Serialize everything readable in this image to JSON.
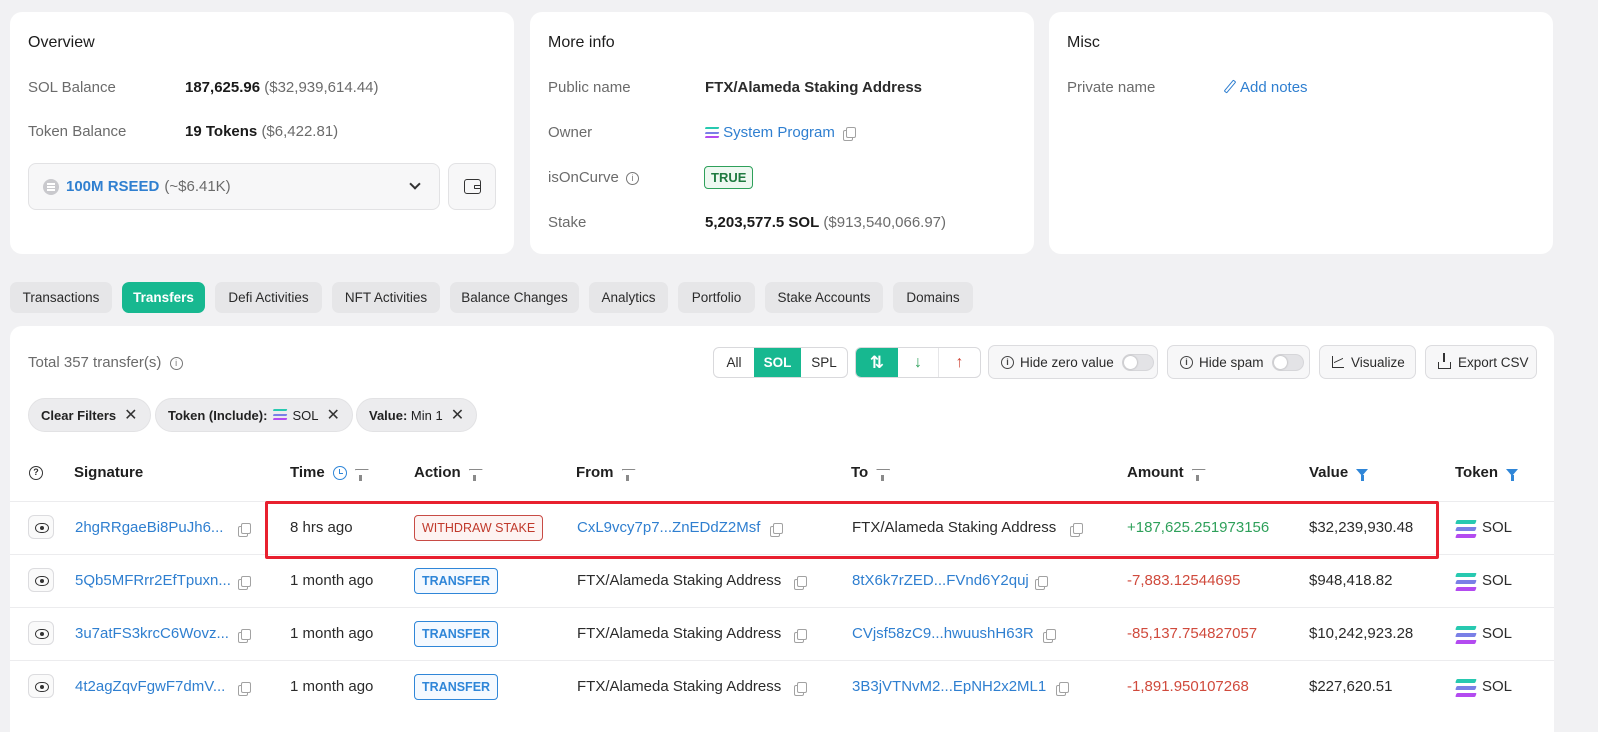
{
  "overview": {
    "title": "Overview",
    "sol_balance_label": "SOL Balance",
    "sol_balance_value": "187,625.96",
    "sol_balance_usd": "($32,939,614.44)",
    "token_balance_label": "Token Balance",
    "token_balance_value": "19 Tokens",
    "token_balance_usd": "($6,422.81)",
    "token_select_value": "100M RSEED",
    "token_select_usd": "(~$6.41K)"
  },
  "more_info": {
    "title": "More info",
    "public_name_label": "Public name",
    "public_name_value": "FTX/Alameda Staking Address",
    "owner_label": "Owner",
    "owner_value": "System Program",
    "is_on_curve_label": "isOnCurve",
    "is_on_curve_value": "TRUE",
    "stake_label": "Stake",
    "stake_value": "5,203,577.5 SOL",
    "stake_usd": "($913,540,066.97)"
  },
  "misc": {
    "title": "Misc",
    "private_name_label": "Private name",
    "add_notes": "Add notes"
  },
  "tabs": [
    "Transactions",
    "Transfers",
    "Defi Activities",
    "NFT Activities",
    "Balance Changes",
    "Analytics",
    "Portfolio",
    "Stake Accounts",
    "Domains"
  ],
  "active_tab": "Transfers",
  "toolbar": {
    "total": "Total 357 transfer(s)",
    "filter_all": "All",
    "filter_sol": "SOL",
    "filter_spl": "SPL",
    "hide_zero": "Hide zero value",
    "hide_spam": "Hide spam",
    "visualize": "Visualize",
    "export_csv": "Export CSV"
  },
  "chips": {
    "clear": "Clear Filters",
    "token_label": "Token (Include):",
    "token_value": "SOL",
    "value_label": "Value:",
    "value_value": "Min 1"
  },
  "table": {
    "headers": {
      "signature": "Signature",
      "time": "Time",
      "action": "Action",
      "from": "From",
      "to": "To",
      "amount": "Amount",
      "value": "Value",
      "token": "Token"
    },
    "rows": [
      {
        "signature": "2hgRRgaeBi8PuJh6...",
        "time": "8 hrs ago",
        "action": "WITHDRAW STAKE",
        "from": "CxL9vcy7p7...ZnEDdZ2Msf",
        "to": "FTX/Alameda Staking Address",
        "amount": "+187,625.251973156",
        "value": "$32,239,930.48",
        "token": "SOL"
      },
      {
        "signature": "5Qb5MFRrr2EfTpuxn...",
        "time": "1 month ago",
        "action": "TRANSFER",
        "from": "FTX/Alameda Staking Address",
        "to": "8tX6k7rZED...FVnd6Y2quj",
        "amount": "-7,883.12544695",
        "value": "$948,418.82",
        "token": "SOL"
      },
      {
        "signature": "3u7atFS3krcC6Wovz...",
        "time": "1 month ago",
        "action": "TRANSFER",
        "from": "FTX/Alameda Staking Address",
        "to": "CVjsf58zC9...hwuushH63R",
        "amount": "-85,137.754827057",
        "value": "$10,242,923.28",
        "token": "SOL"
      },
      {
        "signature": "4t2agZqvFgwF7dmV...",
        "time": "1 month ago",
        "action": "TRANSFER",
        "from": "FTX/Alameda Staking Address",
        "to": "3B3jVTNvM2...EpNH2x2ML1",
        "amount": "-1,891.950107268",
        "value": "$227,620.51",
        "token": "SOL"
      }
    ]
  },
  "colors": {
    "accent": "#17b890",
    "link": "#2f7fd0",
    "positive": "#2ea05a",
    "negative": "#d04a3c",
    "highlight_box": "#e8202f"
  }
}
